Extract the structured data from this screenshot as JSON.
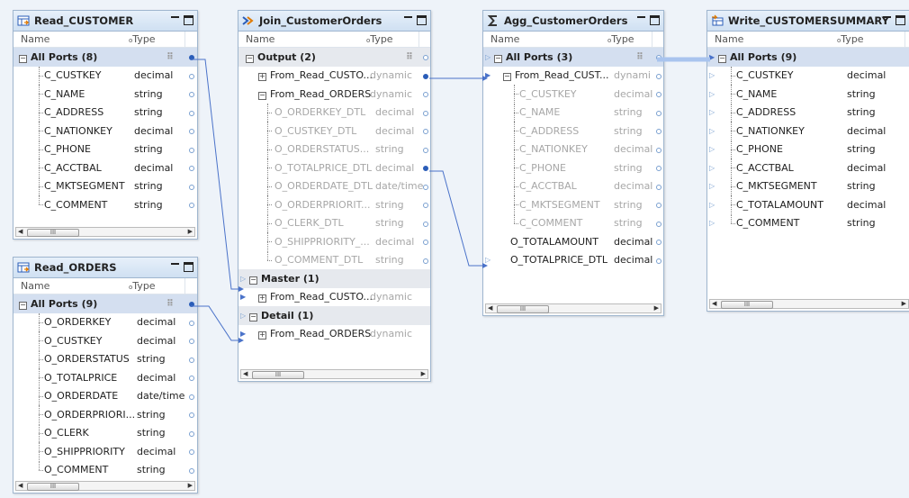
{
  "colors": {
    "link": "#4a72c9",
    "accent": "#2a5db8",
    "header_bg": "#cfe0f2",
    "canvas": "#eef3f9"
  },
  "column_headers": {
    "name": "Name",
    "type": "Type"
  },
  "read_customer": {
    "title": "Read_CUSTOMER",
    "icon": "read-source-icon",
    "group": "All Ports (8)",
    "ports": [
      {
        "name": "C_CUSTKEY",
        "type": "decimal"
      },
      {
        "name": "C_NAME",
        "type": "string"
      },
      {
        "name": "C_ADDRESS",
        "type": "string"
      },
      {
        "name": "C_NATIONKEY",
        "type": "decimal"
      },
      {
        "name": "C_PHONE",
        "type": "string"
      },
      {
        "name": "C_ACCTBAL",
        "type": "decimal"
      },
      {
        "name": "C_MKTSEGMENT",
        "type": "string"
      },
      {
        "name": "C_COMMENT",
        "type": "string"
      }
    ]
  },
  "read_orders": {
    "title": "Read_ORDERS",
    "icon": "read-source-icon",
    "group": "All Ports (9)",
    "ports": [
      {
        "name": "O_ORDERKEY",
        "type": "decimal"
      },
      {
        "name": "O_CUSTKEY",
        "type": "decimal"
      },
      {
        "name": "O_ORDERSTATUS",
        "type": "string"
      },
      {
        "name": "O_TOTALPRICE",
        "type": "decimal"
      },
      {
        "name": "O_ORDERDATE",
        "type": "date/time"
      },
      {
        "name": "O_ORDERPRIORI...",
        "type": "string"
      },
      {
        "name": "O_CLERK",
        "type": "string"
      },
      {
        "name": "O_SHIPPRIORITY",
        "type": "decimal"
      },
      {
        "name": "O_COMMENT",
        "type": "string"
      }
    ]
  },
  "join": {
    "title": "Join_CustomerOrders",
    "icon": "joiner-icon",
    "output_group": "Output (2)",
    "output_rows": [
      {
        "name": "From_Read_CUSTO...",
        "type": "dynamic"
      },
      {
        "name": "From_Read_ORDERS",
        "type": "dynamic"
      }
    ],
    "detail_ports": [
      {
        "name": "O_ORDERKEY_DTL",
        "type": "decimal"
      },
      {
        "name": "O_CUSTKEY_DTL",
        "type": "decimal"
      },
      {
        "name": "O_ORDERSTATUS...",
        "type": "string"
      },
      {
        "name": "O_TOTALPRICE_DTL",
        "type": "decimal"
      },
      {
        "name": "O_ORDERDATE_DTL",
        "type": "date/time"
      },
      {
        "name": "O_ORDERPRIORIT...",
        "type": "string"
      },
      {
        "name": "O_CLERK_DTL",
        "type": "string"
      },
      {
        "name": "O_SHIPPRIORITY_...",
        "type": "decimal"
      },
      {
        "name": "O_COMMENT_DTL",
        "type": "string"
      }
    ],
    "master_group": "Master (1)",
    "master_row": {
      "name": "From_Read_CUSTO...",
      "type": "dynamic"
    },
    "detail_group": "Detail (1)",
    "detail_row": {
      "name": "From_Read_ORDERS",
      "type": "dynamic"
    }
  },
  "agg": {
    "title": "Agg_CustomerOrders",
    "icon": "sigma-icon",
    "group": "All Ports (3)",
    "sub_row": {
      "name": "From_Read_CUST...",
      "type": "dynami"
    },
    "sub_ports": [
      {
        "name": "C_CUSTKEY",
        "type": "decimal"
      },
      {
        "name": "C_NAME",
        "type": "string"
      },
      {
        "name": "C_ADDRESS",
        "type": "string"
      },
      {
        "name": "C_NATIONKEY",
        "type": "decimal"
      },
      {
        "name": "C_PHONE",
        "type": "string"
      },
      {
        "name": "C_ACCTBAL",
        "type": "decimal"
      },
      {
        "name": "C_MKTSEGMENT",
        "type": "string"
      },
      {
        "name": "C_COMMENT",
        "type": "string"
      }
    ],
    "ports": [
      {
        "name": "O_TOTALAMOUNT",
        "type": "decimal"
      },
      {
        "name": "O_TOTALPRICE_DTL",
        "type": "decimal"
      }
    ]
  },
  "write": {
    "title": "Write_CUSTOMERSUMMARY",
    "icon": "write-target-icon",
    "group": "All Ports (9)",
    "ports": [
      {
        "name": "C_CUSTKEY",
        "type": "decimal"
      },
      {
        "name": "C_NAME",
        "type": "string"
      },
      {
        "name": "C_ADDRESS",
        "type": "string"
      },
      {
        "name": "C_NATIONKEY",
        "type": "decimal"
      },
      {
        "name": "C_PHONE",
        "type": "string"
      },
      {
        "name": "C_ACCTBAL",
        "type": "decimal"
      },
      {
        "name": "C_MKTSEGMENT",
        "type": "string"
      },
      {
        "name": "C_TOTALAMOUNT",
        "type": "decimal"
      },
      {
        "name": "C_COMMENT",
        "type": "string"
      }
    ]
  },
  "scroll_thumb_glyph": "III"
}
